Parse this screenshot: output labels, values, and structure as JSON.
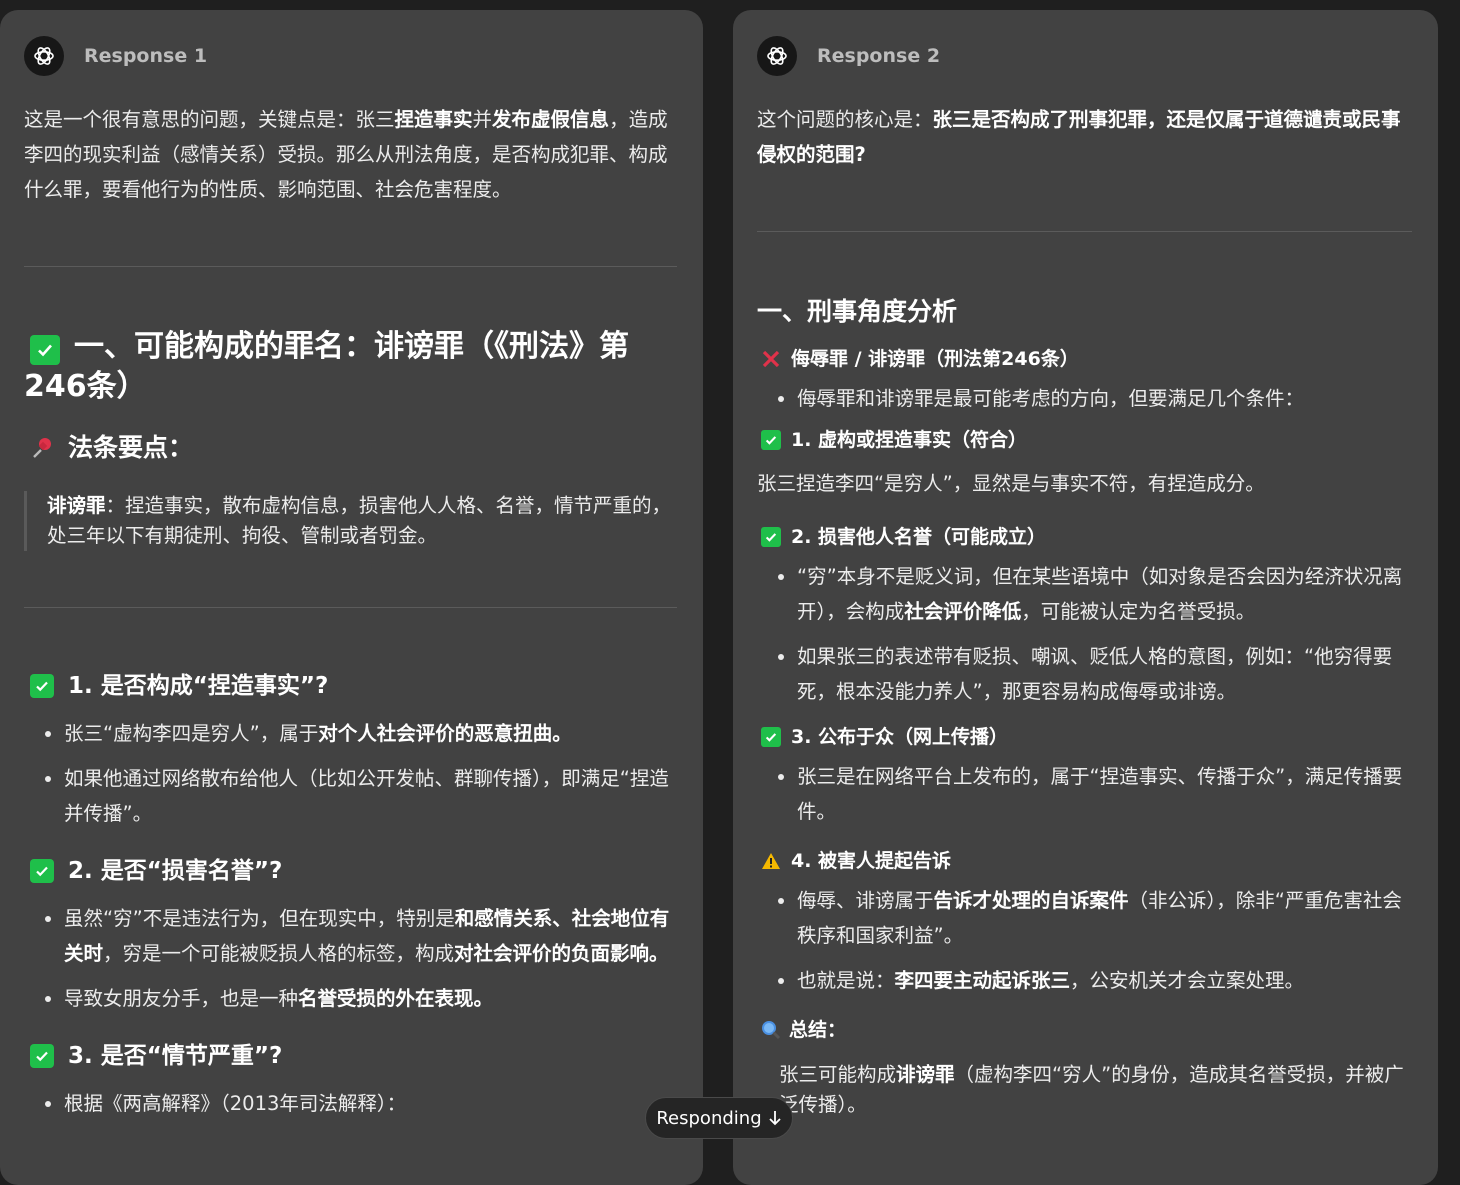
{
  "r1": {
    "title": "Response 1",
    "intro_a": "这是一个很有意思的问题，关键点是：张三",
    "intro_b1": "捏造事实",
    "intro_a2": "并",
    "intro_b2": "发布虚假信息",
    "intro_c": "，造成李四的现实利益（感情关系）受损。那么从刑法角度，是否构成犯罪、构成什么罪，要看他行为的性质、影响范围、社会危害程度。",
    "h_crime": "一、可能构成的罪名：诽谤罪（《刑法》第246条）",
    "h_points": "法条要点：",
    "quote_b": "诽谤罪",
    "quote_t": "：捏造事实，散布虚构信息，损害他人人格、名誉，情节严重的，处三年以下有期徒刑、拘役、管制或者罚金。",
    "s1": "1. 是否构成“捏造事实”?",
    "s1_li1_a": "张三“虚构李四是穷人”，属于",
    "s1_li1_b": "对个人社会评价的恶意扭曲。",
    "s1_li2": "如果他通过网络散布给他人（比如公开发帖、群聊传播），即满足“捏造并传播”。",
    "s2": "2. 是否“损害名誉”?",
    "s2_li1_a": "虽然“穷”不是违法行为，但在现实中，特别是",
    "s2_li1_b": "和感情关系、社会地位有关时",
    "s2_li1_c": "，穷是一个可能被贬损人格的标签，构成",
    "s2_li1_d": "对社会评价的负面影响。",
    "s2_li2_a": "导致女朋友分手，也是一种",
    "s2_li2_b": "名誉受损的外在表现。",
    "s3": "3. 是否“情节严重”?",
    "s3_li1": "根据《两高解释》（2013年司法解释）："
  },
  "r2": {
    "title": "Response 2",
    "intro_a": "这个问题的核心是：",
    "intro_b": "张三是否构成了刑事犯罪，还是仅属于道德谴责或民事侵权的范围?",
    "h_crim": "一、刑事角度分析",
    "h_insult": "侮辱罪 / 诽谤罪（刑法第246条）",
    "insult_li": "侮辱罪和诽谤罪是最可能考虑的方向，但要满足几个条件：",
    "c1": "1. 虚构或捏造事实（符合）",
    "c1_p": "张三捏造李四“是穷人”，显然是与事实不符，有捏造成分。",
    "c2": "2. 损害他人名誉（可能成立）",
    "c2_li1_a": "“穷”本身不是贬义词，但在某些语境中（如对象是否会因为经济状况离开），会构成",
    "c2_li1_b": "社会评价降低",
    "c2_li1_c": "，可能被认定为名誉受损。",
    "c2_li2": "如果张三的表述带有贬损、嘲讽、贬低人格的意图，例如：“他穷得要死，根本没能力养人”，那更容易构成侮辱或诽谤。",
    "c3": "3. 公布于众（网上传播）",
    "c3_li": "张三是在网络平台上发布的，属于“捏造事实、传播于众”，满足传播要件。",
    "c4": "4. 被害人提起告诉",
    "c4_li1_a": "侮辱、诽谤属于",
    "c4_li1_b": "告诉才处理的自诉案件",
    "c4_li1_c": "（非公诉），除非“严重危害社会秩序和国家利益”。",
    "c4_li2_a": "也就是说：",
    "c4_li2_b": "李四要主动起诉张三",
    "c4_li2_c": "，公安机关才会立案处理。",
    "sum_h": "总结：",
    "sum_a": "张三可能构成",
    "sum_b": "诽谤罪",
    "sum_c": "（虚构李四“穷人”的身份，造成其名誉受损，并被广泛传播）。"
  },
  "status": {
    "responding": "Responding"
  },
  "colors": {
    "check": "#1fbf4a",
    "cross": "#e0324a",
    "warn": "#f5b800",
    "panel": "#424242",
    "bg": "#1f1f1f"
  }
}
